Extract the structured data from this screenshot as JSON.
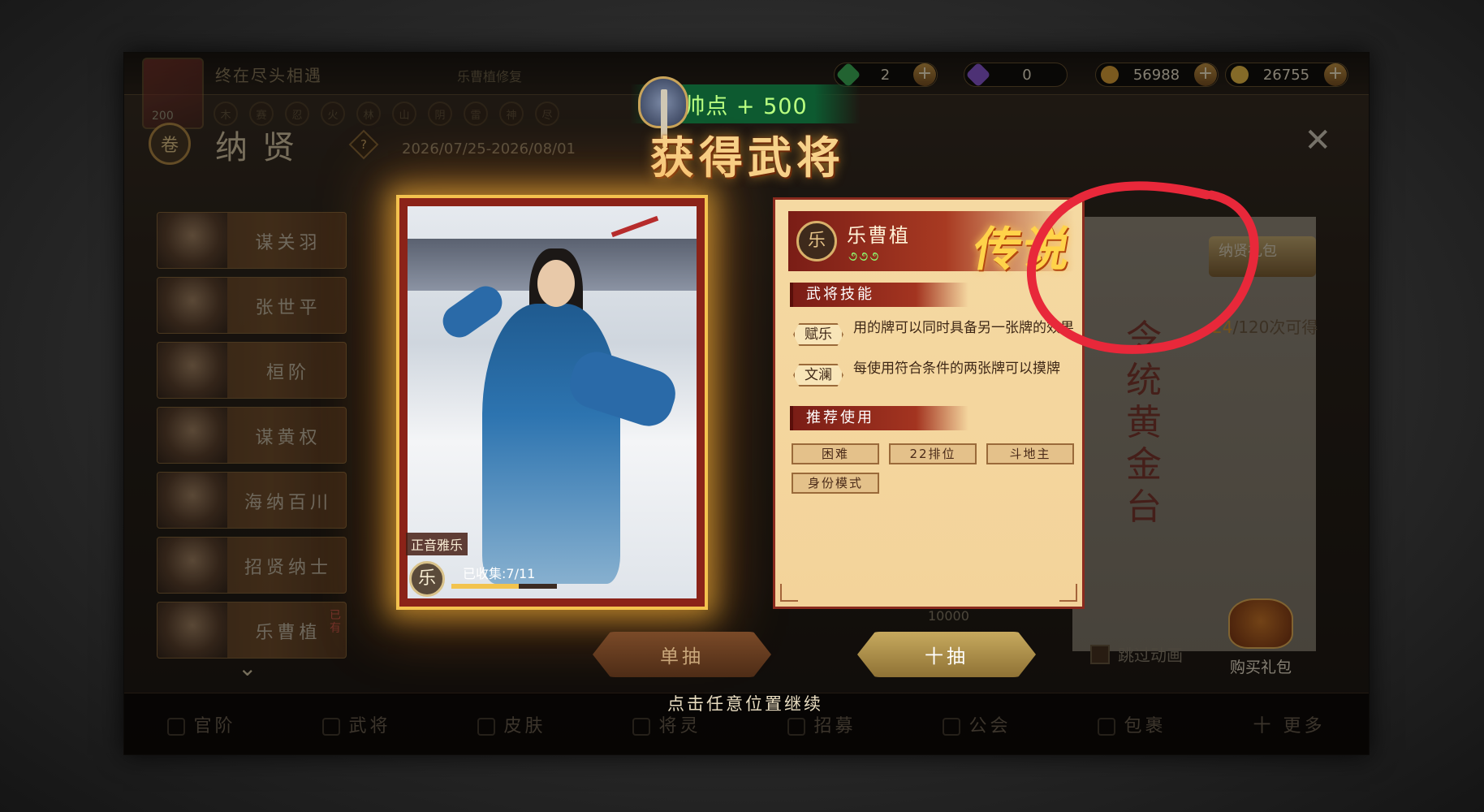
{
  "top_bar": {
    "title": "终在尽头相遇",
    "subtitle": "乐曹植修复",
    "avatar_number": "200",
    "elements": [
      "木",
      "赛",
      "忍",
      "火",
      "林",
      "山",
      "阴",
      "雷",
      "神",
      "尽"
    ],
    "resources": [
      {
        "value": "2",
        "icon": "green-ticket-icon",
        "color": "#3fb45a"
      },
      {
        "value": "0",
        "icon": "purple-ticket-icon",
        "color": "#8d5ad6"
      },
      {
        "value": "56988",
        "icon": "gold-ingot-icon",
        "color": "#e0a53a"
      },
      {
        "value": "26755",
        "icon": "gold-coin-icon",
        "color": "#f0c24a"
      }
    ]
  },
  "header": {
    "title": "纳贤",
    "help": "?",
    "date_range": "2026/07/25-2026/08/01",
    "close": "✕"
  },
  "sidebar": {
    "items": [
      {
        "label": "谋关羽",
        "owned": ""
      },
      {
        "label": "张世平",
        "owned": ""
      },
      {
        "label": "桓阶",
        "owned": ""
      },
      {
        "label": "谋黄权",
        "owned": ""
      },
      {
        "label": "海纳百川",
        "owned": ""
      },
      {
        "label": "招贤纳士",
        "owned": ""
      },
      {
        "label": "乐曹植",
        "owned": "已有"
      }
    ],
    "more_icon": "chevron-down-icon"
  },
  "background_panel": {
    "libao_label": "纳贤礼包",
    "counter_current": "24",
    "counter_rest": "/120次可得",
    "vertical_text": "令统黄金台",
    "cost": "10000",
    "skip_label": "跳过动画",
    "gift_label": "购买礼包"
  },
  "overlay": {
    "banner": "帅点 + 500",
    "title": "获得武将",
    "continue_hint": "点击任意位置继续"
  },
  "card": {
    "skin_name": "正音雅乐",
    "badge": "乐",
    "collected": "已收集:7/11",
    "collect_progress": 0.636
  },
  "info": {
    "emblem": "乐",
    "name": "乐曹植",
    "stars": "૭૭૭",
    "rarity": "传说",
    "skills_heading": "武将技能",
    "skills": [
      {
        "tag": "赋乐",
        "desc": "用的牌可以同时具备另一张牌的效果"
      },
      {
        "tag": "文澜",
        "desc": "每使用符合条件的两张牌可以摸牌"
      }
    ],
    "recommend_heading": "推荐使用",
    "modes": [
      "困难",
      "22排位",
      "斗地主",
      "身份模式"
    ]
  },
  "buttons": {
    "single": "单抽",
    "ten": "十抽"
  },
  "tabs": [
    "官阶",
    "武将",
    "皮肤",
    "将灵",
    "招募",
    "公会",
    "包裹",
    "十 更多"
  ],
  "annotation_color": "#e8283a"
}
